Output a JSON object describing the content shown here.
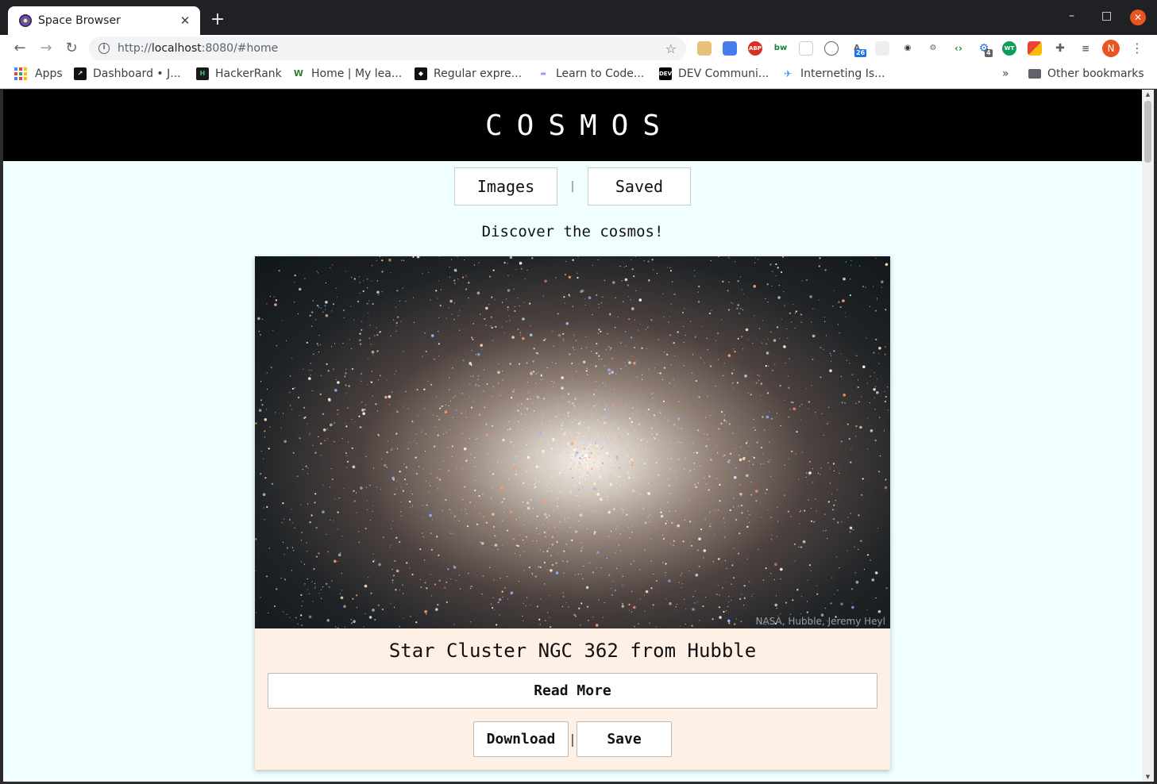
{
  "browser": {
    "tab_title": "Space Browser",
    "tab_close": "✕",
    "new_tab": "+",
    "window_controls": {
      "minimize": "–",
      "maximize": "□",
      "close": "✕"
    },
    "url_prefix": "http://",
    "url_host": "localhost",
    "url_rest": ":8080/#home",
    "profile_initial": "N",
    "menu": "⋮",
    "bookmarks": [
      {
        "label": "Apps",
        "icon": "apps-grid-icon"
      },
      {
        "label": "Dashboard • J...",
        "icon": "dashboard-icon"
      },
      {
        "label": "HackerRank",
        "icon": "hackerrank-icon"
      },
      {
        "label": "Home | My lea...",
        "icon": "w-icon"
      },
      {
        "label": "Regular expre...",
        "icon": "regex-icon"
      },
      {
        "label": "Learn to Code...",
        "icon": "code-icon"
      },
      {
        "label": "DEV Communi...",
        "icon": "dev-icon"
      },
      {
        "label": "Interneting Is...",
        "icon": "interneting-icon"
      }
    ],
    "bookmarks_more": "»",
    "other_bookmarks": "Other bookmarks",
    "extension_badges": {
      "ext1": "26",
      "ext2": "4"
    }
  },
  "page": {
    "brand": "COSMOS",
    "nav": {
      "images": "Images",
      "separator": "|",
      "saved": "Saved"
    },
    "tagline": "Discover the cosmos!",
    "card": {
      "title": "Star Cluster NGC 362 from Hubble",
      "credit": "NASA, Hubble, Jeremy Heyl",
      "read_more": "Read More",
      "download": "Download",
      "separator": "|",
      "save": "Save"
    }
  }
}
